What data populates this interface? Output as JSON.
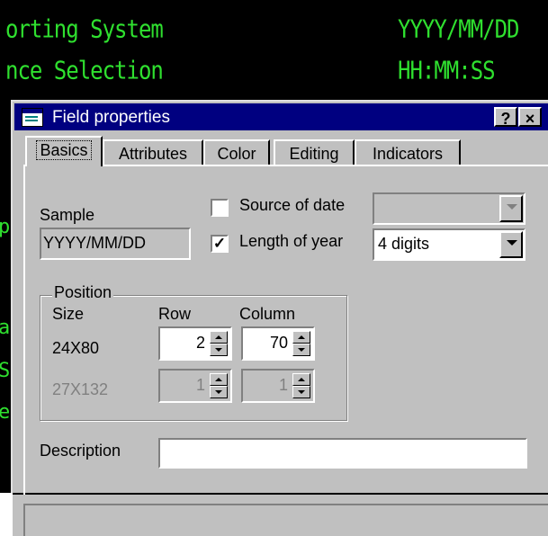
{
  "terminal": {
    "line1_left": "orting System",
    "line1_right": "YYYY/MM/DD",
    "line2_left": "nce Selection",
    "line2_right": "HH:MM:SS",
    "fragments": [
      "p",
      "a",
      "S",
      "e"
    ]
  },
  "dialog": {
    "title": "Field properties",
    "help_button": "?",
    "close_button": "×",
    "tabs": [
      {
        "label": "Basics",
        "active": true
      },
      {
        "label": "Attributes",
        "active": false
      },
      {
        "label": "Color",
        "active": false
      },
      {
        "label": "Editing",
        "active": false
      },
      {
        "label": "Indicators",
        "active": false
      }
    ],
    "basics": {
      "sample_label": "Sample",
      "sample_value": "YYYY/MM/DD",
      "source_of_date_label": "Source of date",
      "source_of_date_checked": false,
      "source_of_date_value": "",
      "length_of_year_label": "Length of year",
      "length_of_year_checked": true,
      "length_of_year_check_mark": "✓",
      "length_of_year_value": "4 digits",
      "position": {
        "title": "Position",
        "size_header": "Size",
        "row_header": "Row",
        "column_header": "Column",
        "rows": [
          {
            "size": "24X80",
            "row": "2",
            "column": "70",
            "enabled": true
          },
          {
            "size": "27X132",
            "row": "1",
            "column": "1",
            "enabled": false
          }
        ]
      },
      "description_label": "Description",
      "description_value": ""
    }
  },
  "colors": {
    "terminal_bg": "#000000",
    "terminal_text": "#2fe02f",
    "titlebar": "#000080",
    "dialog_face": "#c0c0c0"
  }
}
